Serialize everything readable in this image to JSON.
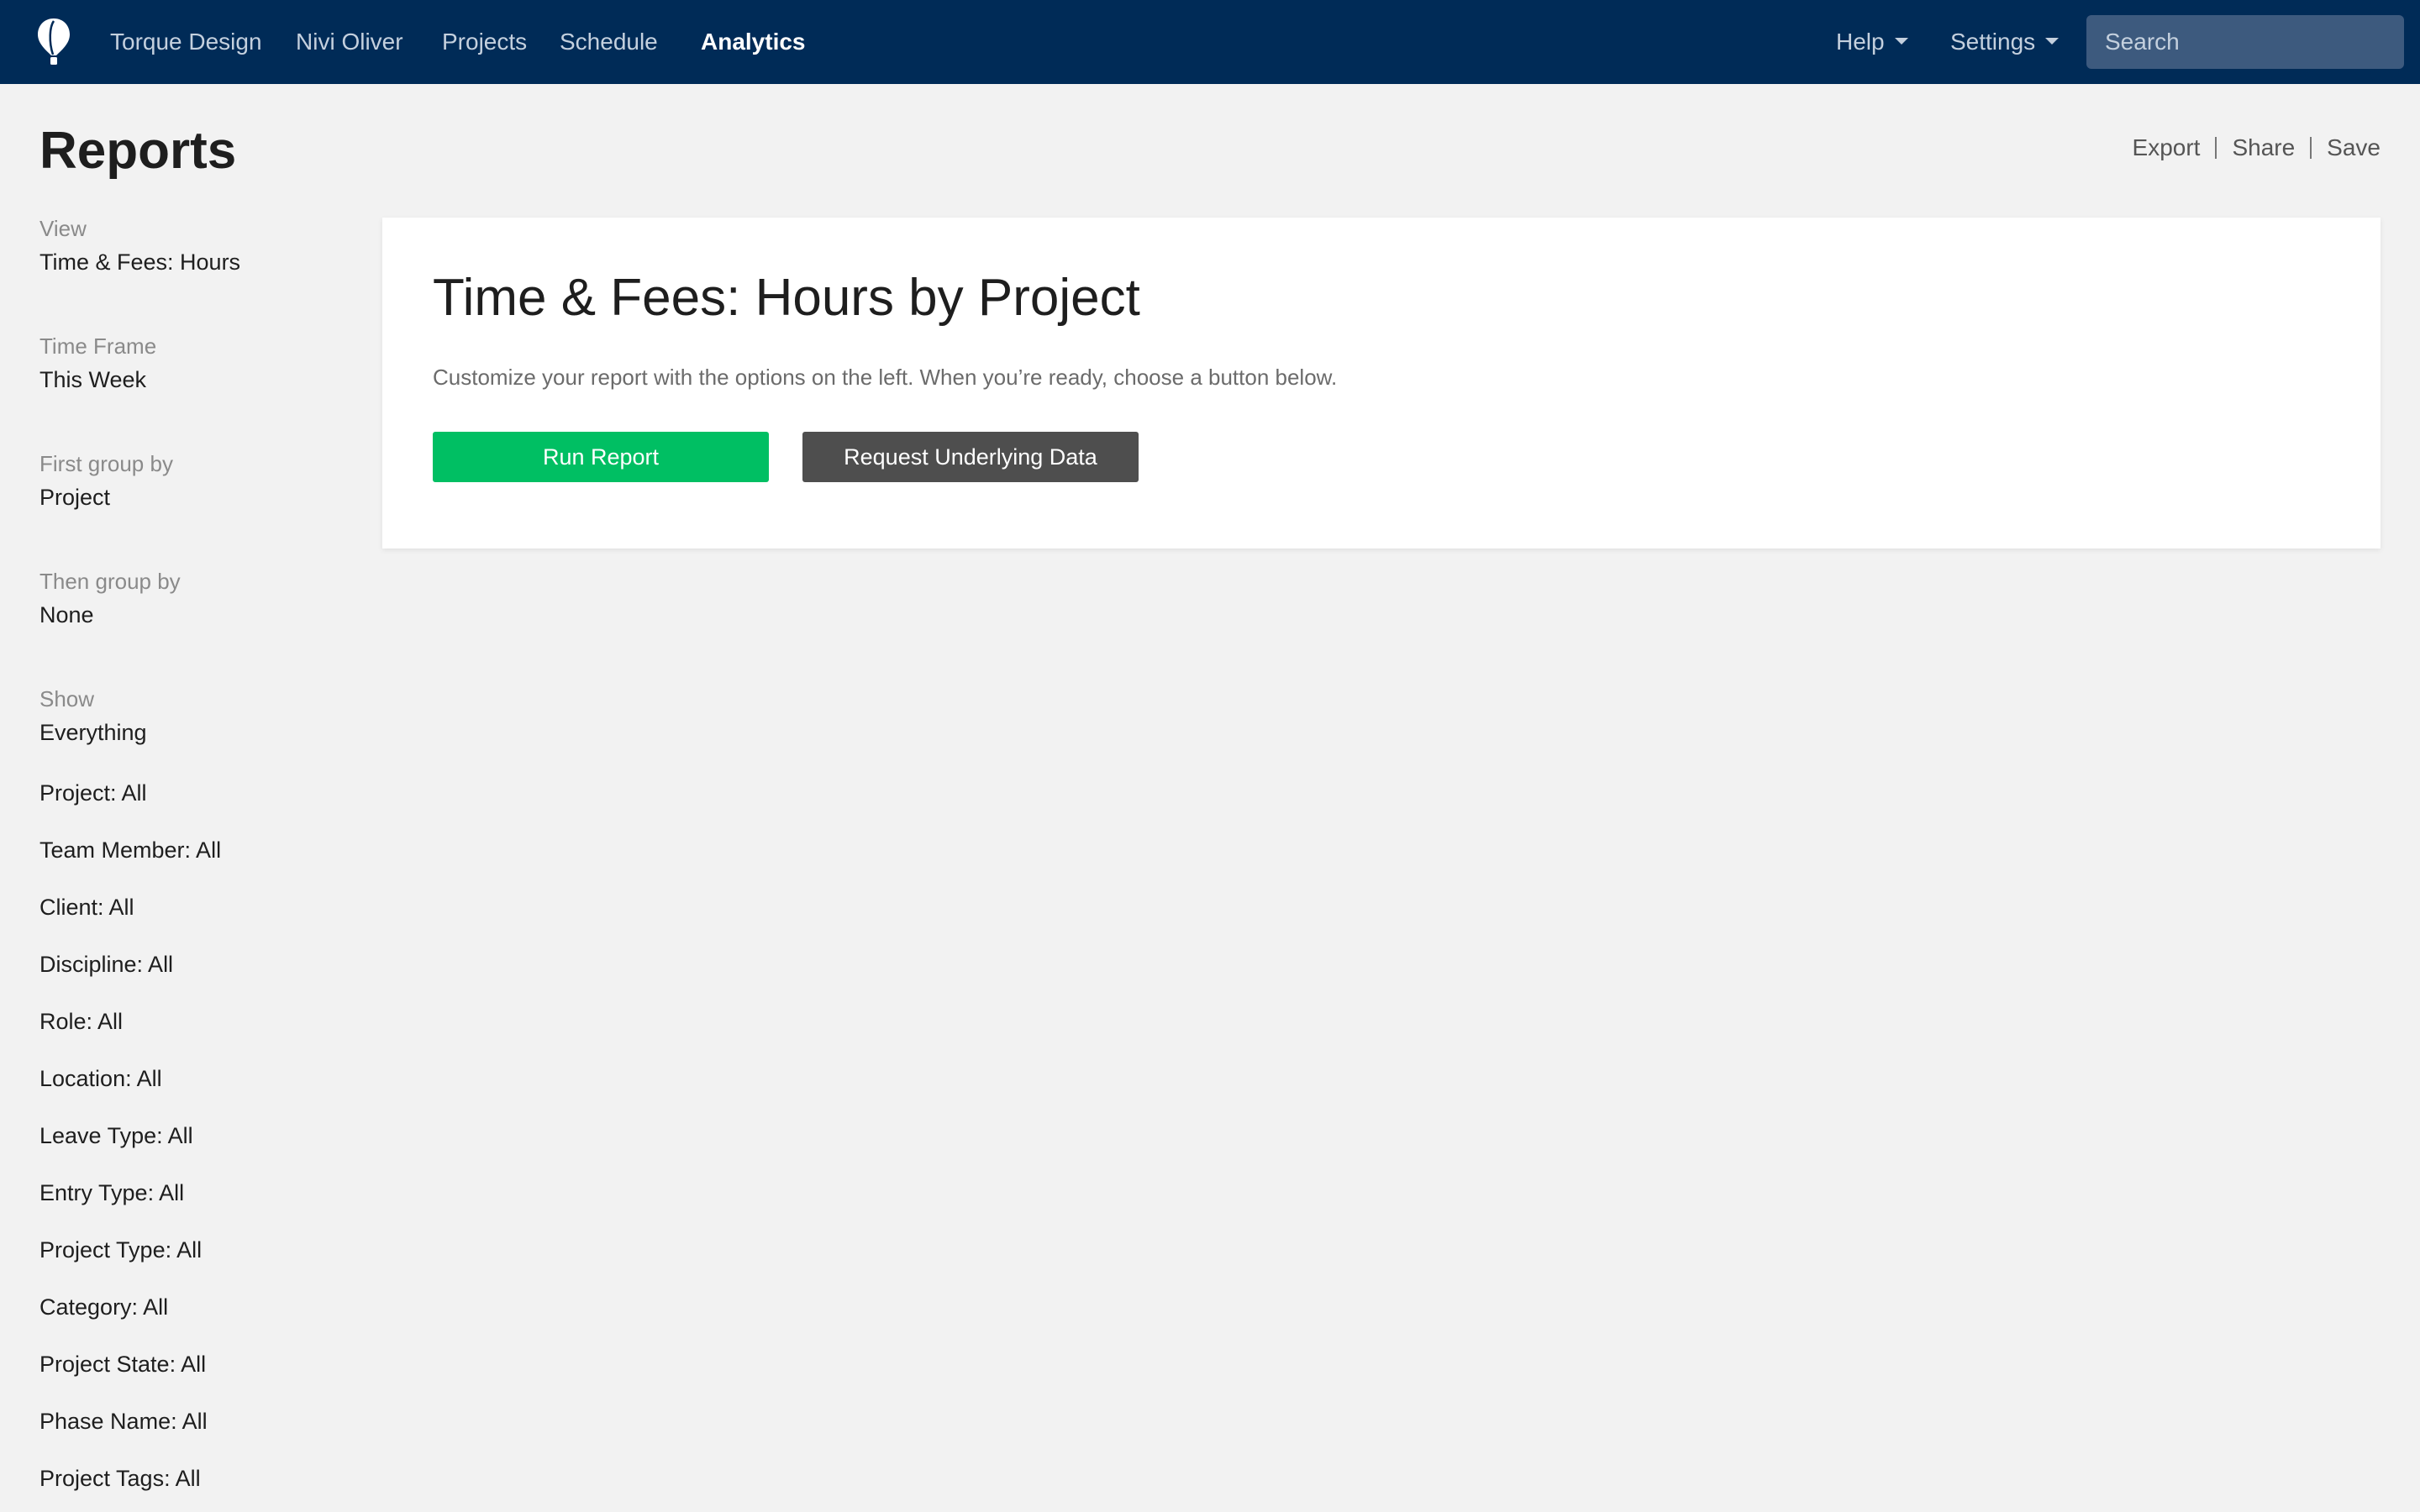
{
  "nav": {
    "links": [
      {
        "label": "Torque Design",
        "active": false
      },
      {
        "label": "Nivi Oliver",
        "active": false
      },
      {
        "label": "Projects",
        "active": false
      },
      {
        "label": "Schedule",
        "active": false
      },
      {
        "label": "Analytics",
        "active": true
      }
    ],
    "help_label": "Help",
    "settings_label": "Settings",
    "search_placeholder": "Search",
    "colors": {
      "background": "#002b57",
      "search_background": "#3d5a7e"
    }
  },
  "page": {
    "title": "Reports",
    "actions": {
      "export": "Export",
      "share": "Share",
      "save": "Save"
    }
  },
  "sidebar": {
    "options": [
      {
        "label": "View",
        "value": "Time & Fees: Hours"
      },
      {
        "label": "Time Frame",
        "value": "This Week"
      },
      {
        "label": "First group by",
        "value": "Project"
      },
      {
        "label": "Then group by",
        "value": "None"
      },
      {
        "label": "Show",
        "value": "Everything"
      }
    ],
    "filters": [
      "Project: All",
      "Team Member: All",
      "Client: All",
      "Discipline: All",
      "Role: All",
      "Location: All",
      "Leave Type: All",
      "Entry Type: All",
      "Project Type: All",
      "Category: All",
      "Project State: All",
      "Phase Name: All",
      "Project Tags: All"
    ]
  },
  "report": {
    "title": "Time & Fees: Hours by Project",
    "description": "Customize your report with the options on the left. When you’re ready, choose a button below.",
    "run_button": "Run Report",
    "data_button": "Request Underlying Data",
    "colors": {
      "run": "#00bf63",
      "data": "#4e4e4e"
    }
  }
}
